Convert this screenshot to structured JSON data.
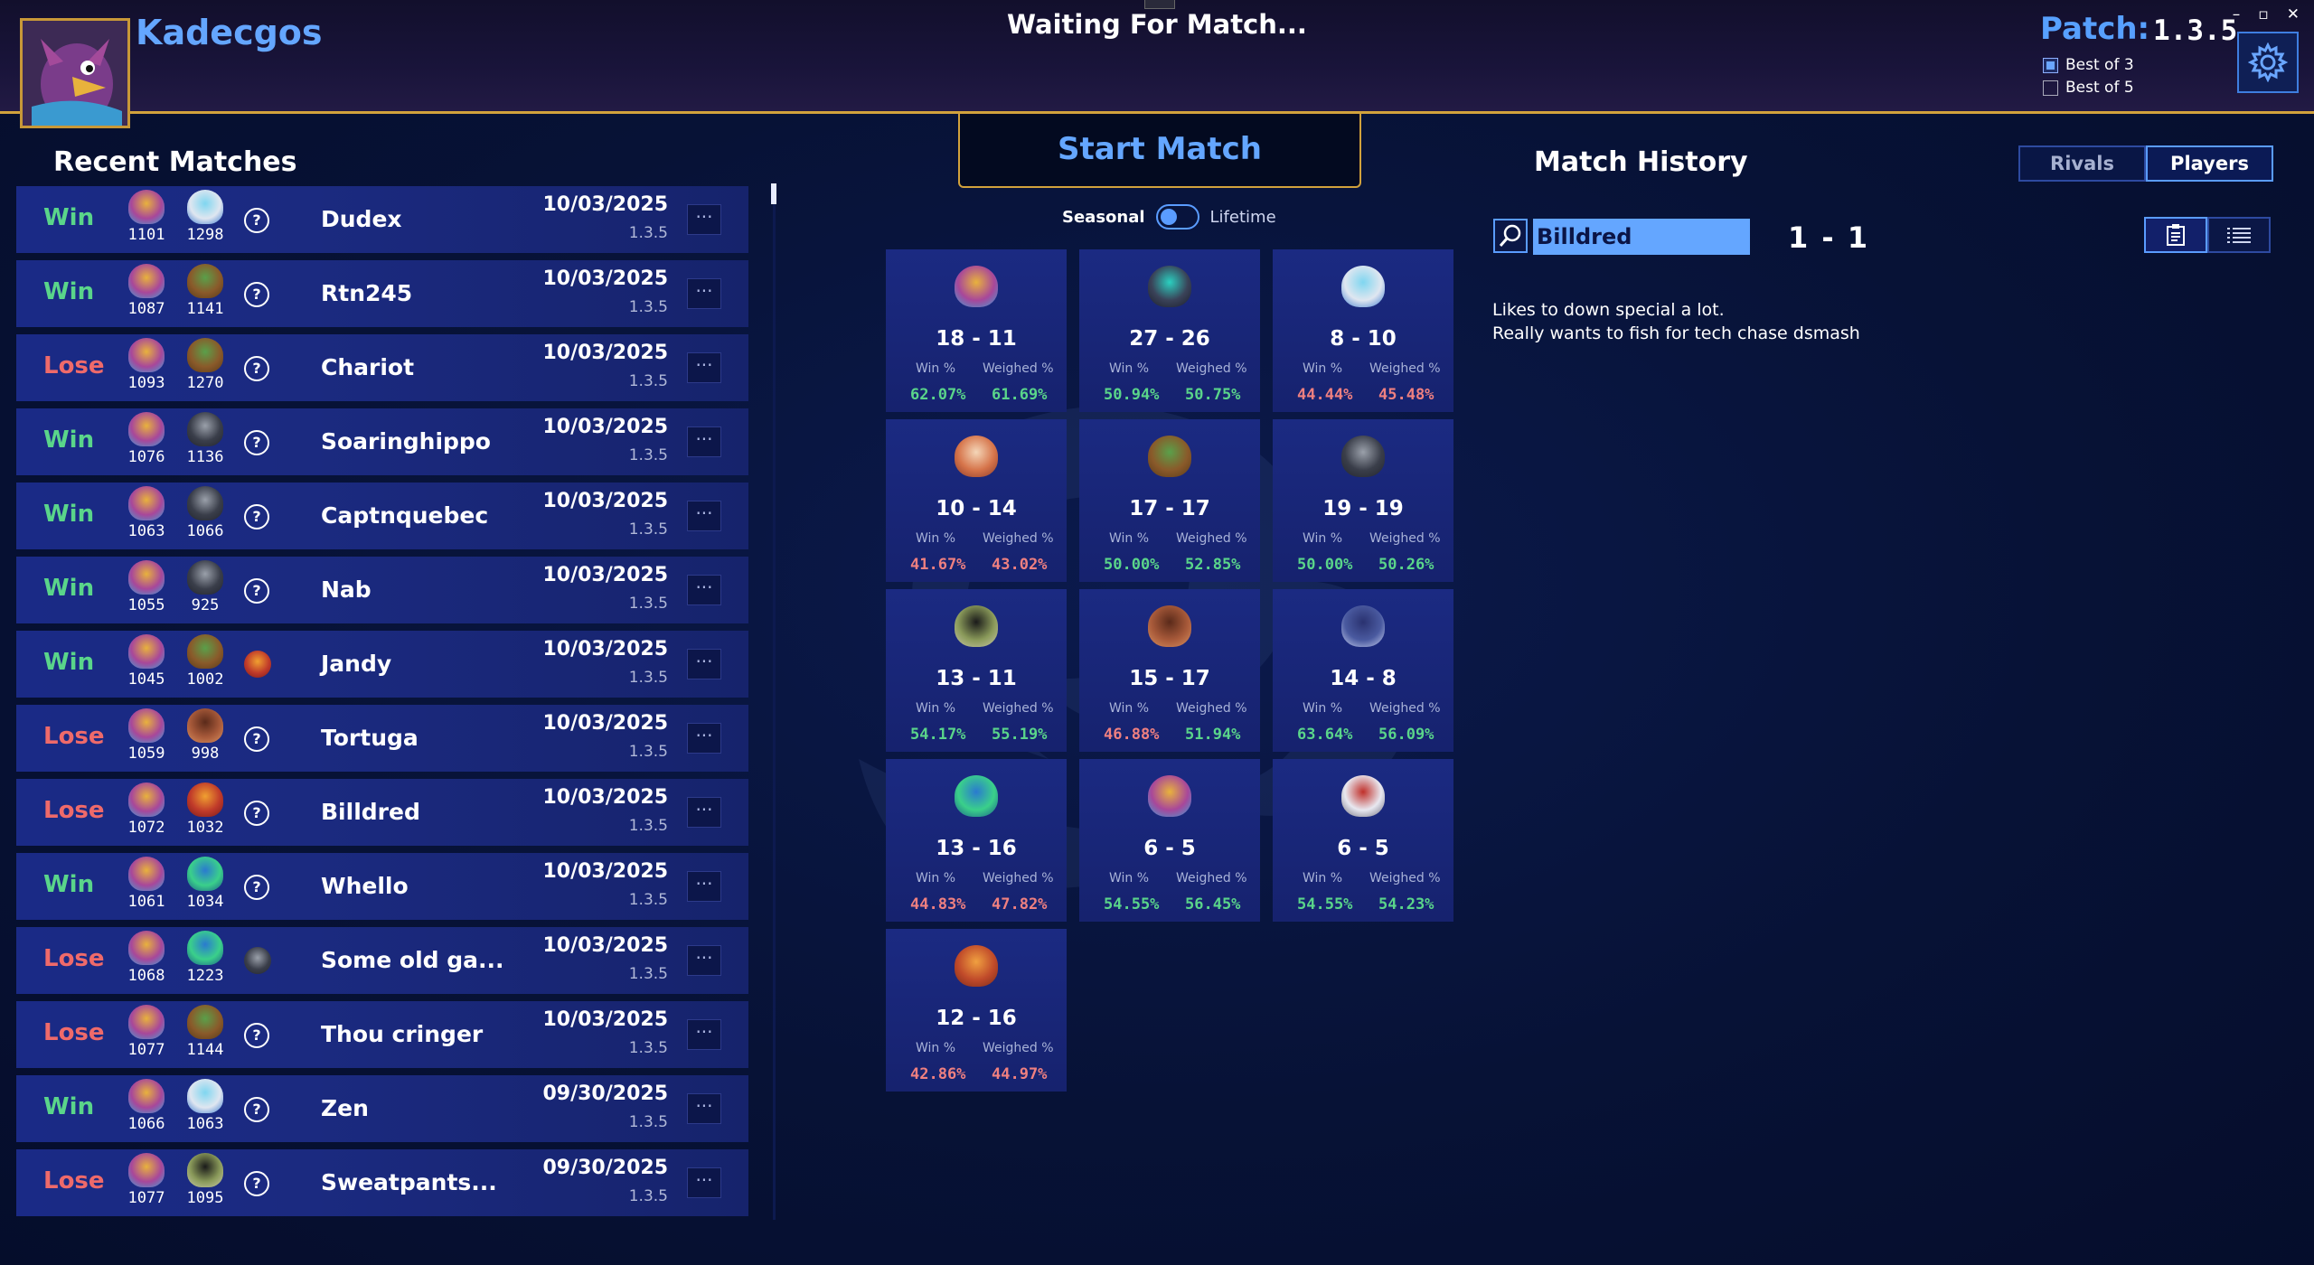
{
  "header": {
    "username": "Kadecgos",
    "status": "Waiting For Match...",
    "patch_label": "Patch:",
    "patch_value": "1.3.5",
    "best_of": [
      {
        "label": "Best of 3",
        "checked": true
      },
      {
        "label": "Best of 5",
        "checked": false
      }
    ],
    "window_controls": [
      "–",
      "▫",
      "✕"
    ]
  },
  "recent_matches": {
    "title": "Recent Matches",
    "more_label": "···",
    "rows": [
      {
        "result": "Win",
        "elo_self": "1101",
        "elo_opp": "1298",
        "opp_char": "polar-bear",
        "opp_main": "?",
        "name": "Dudex",
        "date": "10/03/2025",
        "patch": "1.3.5"
      },
      {
        "result": "Win",
        "elo_self": "1087",
        "elo_opp": "1141",
        "opp_char": "beetle",
        "opp_main": "?",
        "name": "Rtn245",
        "date": "10/03/2025",
        "patch": "1.3.5"
      },
      {
        "result": "Lose",
        "elo_self": "1093",
        "elo_opp": "1270",
        "opp_char": "beetle",
        "opp_main": "?",
        "name": "Chariot",
        "date": "10/03/2025",
        "patch": "1.3.5"
      },
      {
        "result": "Win",
        "elo_self": "1076",
        "elo_opp": "1136",
        "opp_char": "ram",
        "opp_main": "?",
        "name": "Soaringhippo",
        "date": "10/03/2025",
        "patch": "1.3.5"
      },
      {
        "result": "Win",
        "elo_self": "1063",
        "elo_opp": "1066",
        "opp_char": "ram",
        "opp_main": "?",
        "name": "Captnquebec",
        "date": "10/03/2025",
        "patch": "1.3.5"
      },
      {
        "result": "Win",
        "elo_self": "1055",
        "elo_opp": "925",
        "opp_char": "ram",
        "opp_main": "?",
        "name": "Nab",
        "date": "10/03/2025",
        "patch": "1.3.5"
      },
      {
        "result": "Win",
        "elo_self": "1045",
        "elo_opp": "1002",
        "opp_char": "beetle",
        "opp_main": "fire-bird",
        "name": "Jandy",
        "date": "10/03/2025",
        "patch": "1.3.5"
      },
      {
        "result": "Lose",
        "elo_self": "1059",
        "elo_opp": "998",
        "opp_char": "bear",
        "opp_main": "?",
        "name": "Tortuga",
        "date": "10/03/2025",
        "patch": "1.3.5"
      },
      {
        "result": "Lose",
        "elo_self": "1072",
        "elo_opp": "1032",
        "opp_char": "fire-bird",
        "opp_main": "?",
        "name": "Billdred",
        "date": "10/03/2025",
        "patch": "1.3.5"
      },
      {
        "result": "Win",
        "elo_self": "1061",
        "elo_opp": "1034",
        "opp_char": "frog",
        "opp_main": "?",
        "name": "Whello",
        "date": "10/03/2025",
        "patch": "1.3.5"
      },
      {
        "result": "Lose",
        "elo_self": "1068",
        "elo_opp": "1223",
        "opp_char": "frog",
        "opp_main": "ram",
        "name": "Some old ga...",
        "date": "10/03/2025",
        "patch": "1.3.5"
      },
      {
        "result": "Lose",
        "elo_self": "1077",
        "elo_opp": "1144",
        "opp_char": "beetle",
        "opp_main": "?",
        "name": "Thou cringer",
        "date": "10/03/2025",
        "patch": "1.3.5"
      },
      {
        "result": "Win",
        "elo_self": "1066",
        "elo_opp": "1063",
        "opp_char": "polar-bear",
        "opp_main": "?",
        "name": "Zen",
        "date": "09/30/2025",
        "patch": "1.3.5"
      },
      {
        "result": "Lose",
        "elo_self": "1077",
        "elo_opp": "1095",
        "opp_char": "raccoon",
        "opp_main": "?",
        "name": "Sweatpants...",
        "date": "09/30/2025",
        "patch": "1.3.5"
      }
    ]
  },
  "center": {
    "start_label": "Start Match",
    "toggle_on": "Seasonal",
    "toggle_off": "Lifetime",
    "win_label": "Win %",
    "weighed_label": "Weighed %",
    "cards": [
      {
        "char": "owl",
        "record": "18 - 11",
        "win": "62.07%",
        "weighed": "61.69%",
        "win_good": true,
        "weighed_good": true
      },
      {
        "char": "robot",
        "record": "27 - 26",
        "win": "50.94%",
        "weighed": "50.75%",
        "win_good": true,
        "weighed_good": true
      },
      {
        "char": "polar-bear",
        "record": "8 - 10",
        "win": "44.44%",
        "weighed": "45.48%",
        "win_good": false,
        "weighed_good": false
      },
      {
        "char": "fox",
        "record": "10 - 14",
        "win": "41.67%",
        "weighed": "43.02%",
        "win_good": false,
        "weighed_good": false
      },
      {
        "char": "beetle",
        "record": "17 - 17",
        "win": "50.00%",
        "weighed": "52.85%",
        "win_good": true,
        "weighed_good": true
      },
      {
        "char": "ram",
        "record": "19 - 19",
        "win": "50.00%",
        "weighed": "50.26%",
        "win_good": true,
        "weighed_good": true
      },
      {
        "char": "raccoon",
        "record": "13 - 11",
        "win": "54.17%",
        "weighed": "55.19%",
        "win_good": true,
        "weighed_good": true
      },
      {
        "char": "bear",
        "record": "15 - 17",
        "win": "46.88%",
        "weighed": "51.94%",
        "win_good": false,
        "weighed_good": true
      },
      {
        "char": "shark",
        "record": "14 - 8",
        "win": "63.64%",
        "weighed": "56.09%",
        "win_good": true,
        "weighed_good": true
      },
      {
        "char": "frog",
        "record": "13 - 16",
        "win": "44.83%",
        "weighed": "47.82%",
        "win_good": false,
        "weighed_good": false
      },
      {
        "char": "owl",
        "record": "6 - 5",
        "win": "54.55%",
        "weighed": "56.45%",
        "win_good": true,
        "weighed_good": true
      },
      {
        "char": "wolf",
        "record": "6 - 5",
        "win": "54.55%",
        "weighed": "54.23%",
        "win_good": true,
        "weighed_good": true
      },
      {
        "char": "lion",
        "record": "12 - 16",
        "win": "42.86%",
        "weighed": "44.97%",
        "win_good": false,
        "weighed_good": false
      }
    ]
  },
  "match_history": {
    "title": "Match History",
    "tabs": [
      {
        "label": "Rivals",
        "active": false
      },
      {
        "label": "Players",
        "active": true
      }
    ],
    "search_value": "Billdred",
    "score": "1 - 1",
    "notes": [
      "Likes to down special a lot.",
      "Really wants to fish for tech chase dsmash"
    ]
  },
  "colors": {
    "accent": "#64a6ff",
    "gold": "#d2a23c",
    "win": "#5ad58a",
    "lose": "#ef6a6a"
  }
}
